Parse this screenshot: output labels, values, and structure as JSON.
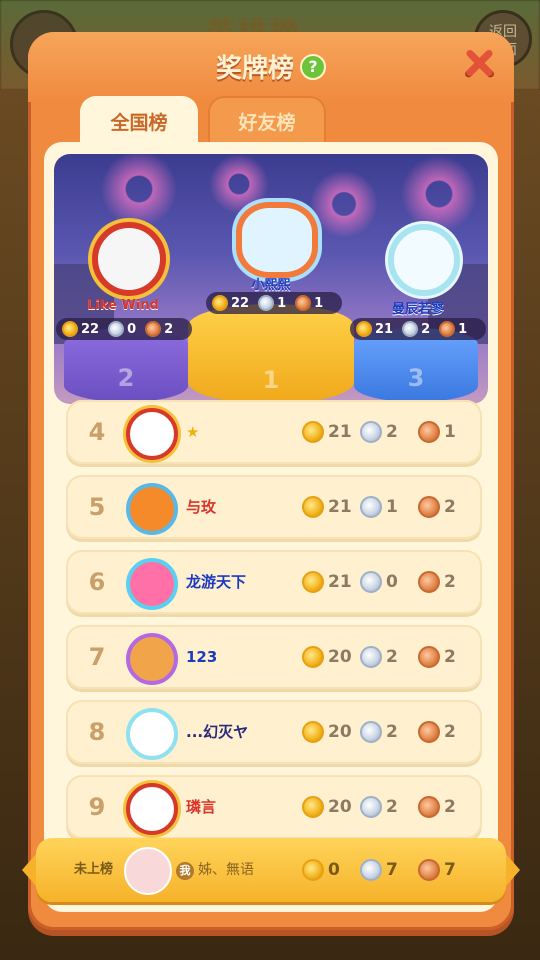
{
  "background": {
    "title": "英雄榜",
    "right_button_label": "返回\n前面"
  },
  "panel": {
    "title": "奖牌榜",
    "help_icon": "question-icon",
    "close_icon": "close-icon"
  },
  "tabs": [
    {
      "label": "全国榜",
      "active": true
    },
    {
      "label": "好友榜",
      "active": false
    }
  ],
  "podium": [
    {
      "rank": "2",
      "name": "Like Wind",
      "gold": "22",
      "silver": "0",
      "bronze": "2"
    },
    {
      "rank": "1",
      "name": "小熙熙",
      "gold": "22",
      "silver": "1",
      "bronze": "1"
    },
    {
      "rank": "3",
      "name": "曼辰若寥",
      "gold": "21",
      "silver": "2",
      "bronze": "1"
    }
  ],
  "rows": [
    {
      "rank": "4",
      "name": "★",
      "gold": "21",
      "silver": "2",
      "bronze": "1"
    },
    {
      "rank": "5",
      "name": "与玫",
      "gold": "21",
      "silver": "1",
      "bronze": "2"
    },
    {
      "rank": "6",
      "name": "龙游天下",
      "gold": "21",
      "silver": "0",
      "bronze": "2"
    },
    {
      "rank": "7",
      "name": "123",
      "gold": "20",
      "silver": "2",
      "bronze": "2"
    },
    {
      "rank": "8",
      "name": "...幻灭ヤ",
      "gold": "20",
      "silver": "2",
      "bronze": "2"
    },
    {
      "rank": "9",
      "name": "璘言",
      "gold": "20",
      "silver": "2",
      "bronze": "2"
    }
  ],
  "me": {
    "rank_label": "未上榜",
    "badge": "我",
    "name": "姊、無语",
    "gold": "0",
    "silver": "7",
    "bronze": "7"
  },
  "colors": {
    "panel": "#f08a3e",
    "inner": "#fff6dc",
    "gold_medal": "#f2b41e",
    "silver_medal": "#c8d4e4",
    "bronze_medal": "#e0844a"
  }
}
